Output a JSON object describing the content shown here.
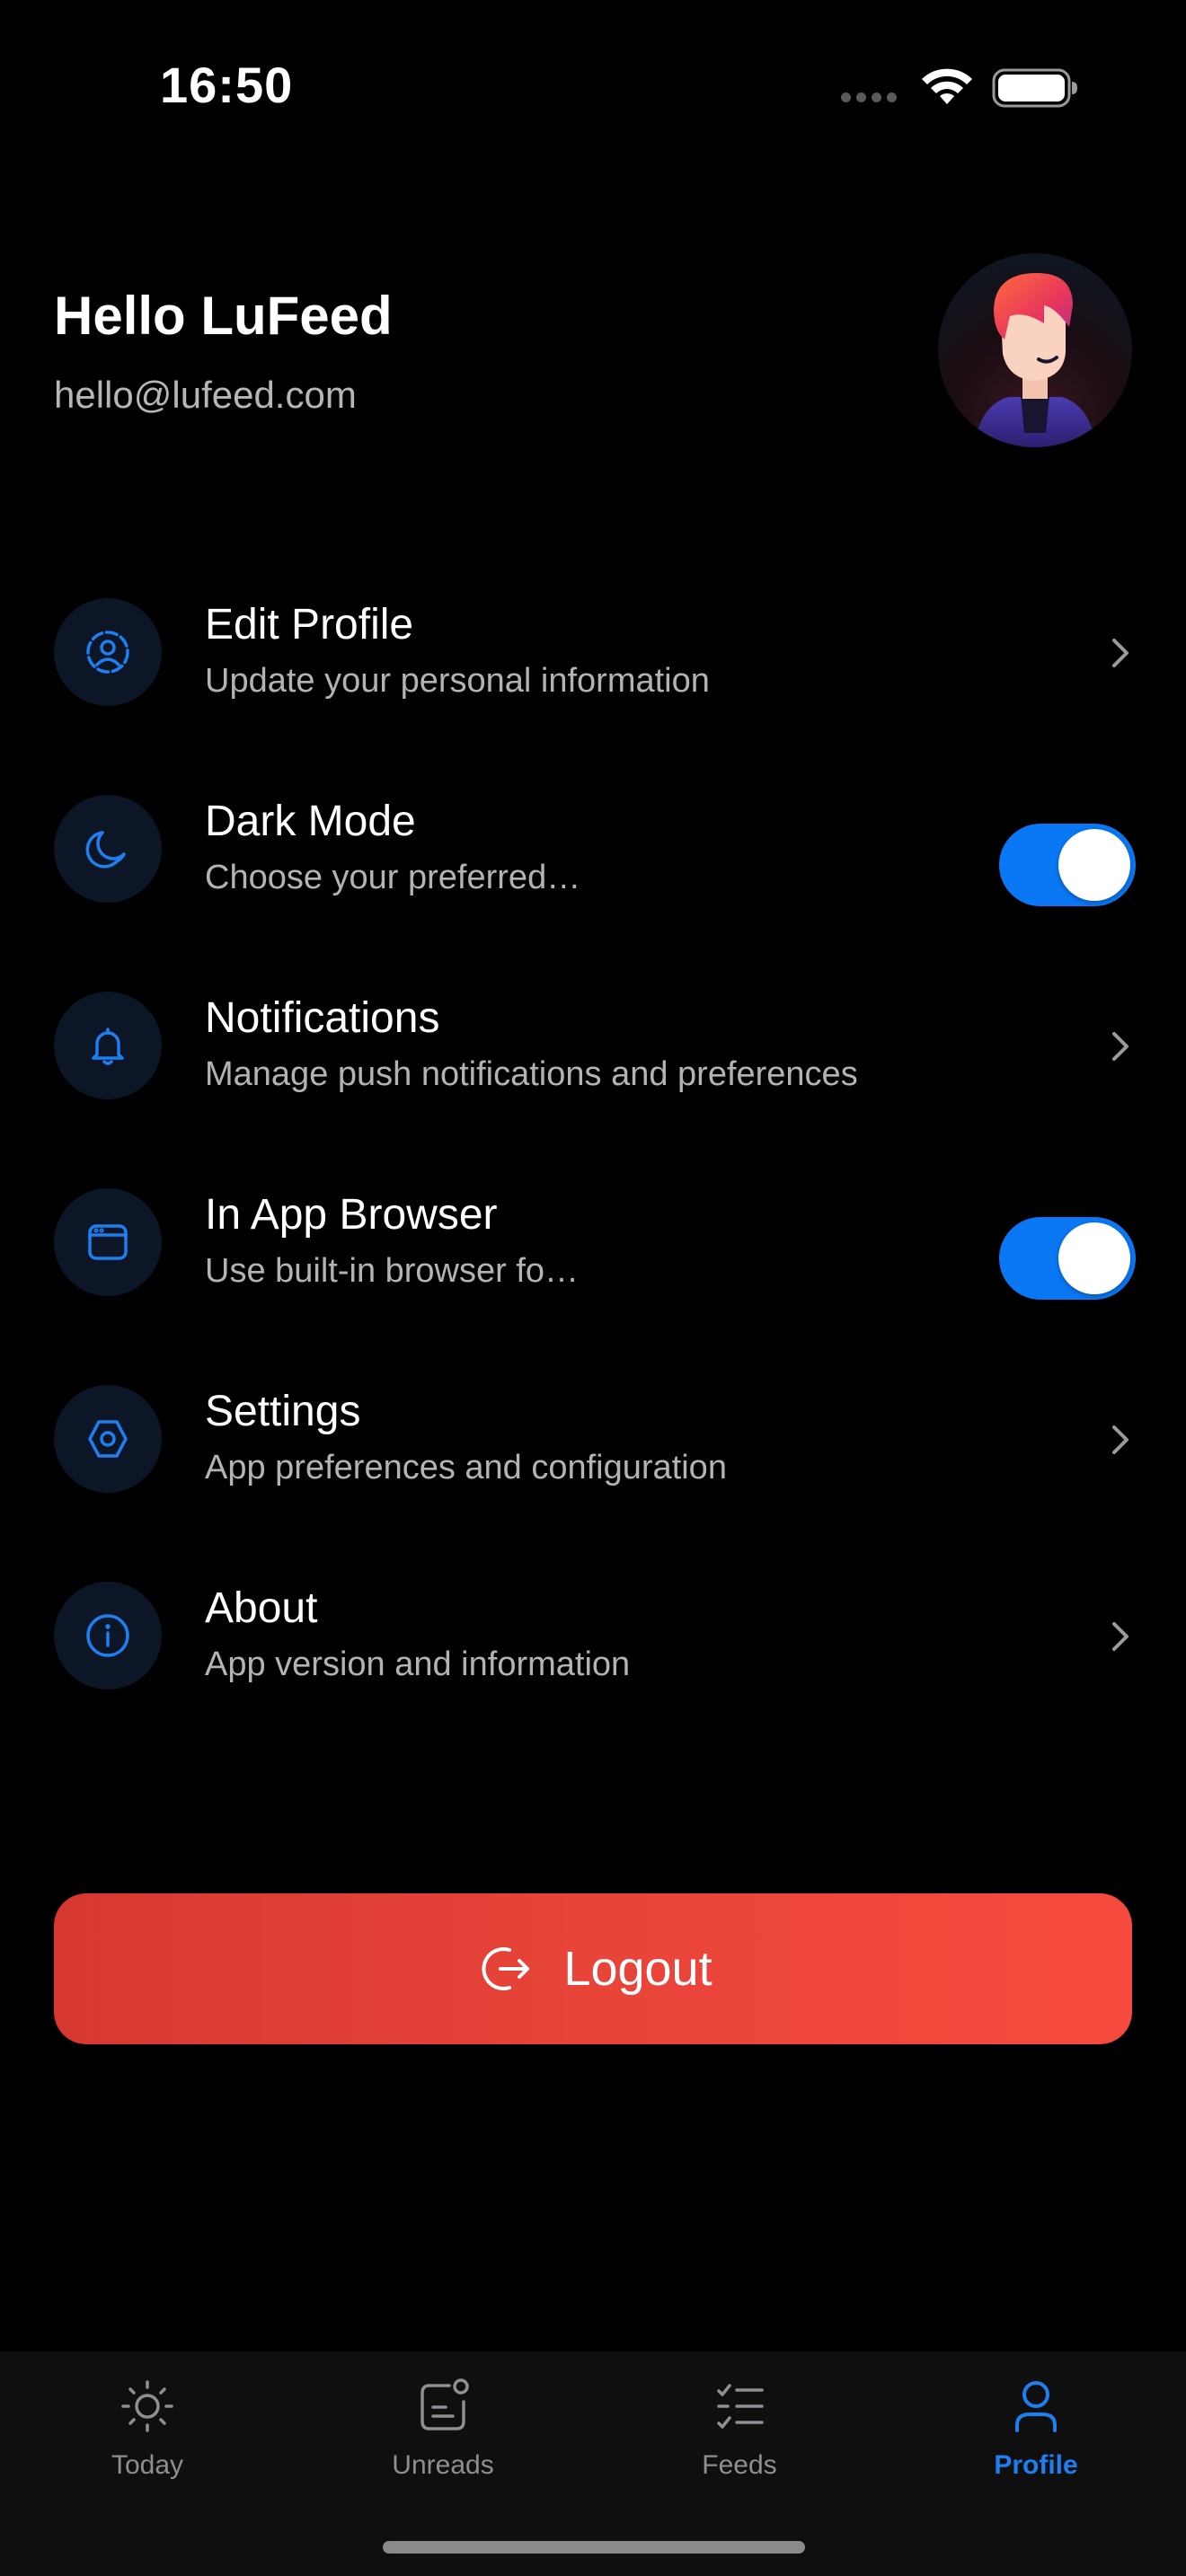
{
  "status_bar": {
    "time": "16:50"
  },
  "header": {
    "greeting": "Hello LuFeed",
    "email": "hello@lufeed.com"
  },
  "menu": {
    "items": [
      {
        "title": "Edit Profile",
        "subtitle": "Update your personal information",
        "icon": "user-circle-icon",
        "control": "chevron"
      },
      {
        "title": "Dark Mode",
        "subtitle": "Choose your preferred…",
        "icon": "moon-icon",
        "control": "toggle",
        "on": true
      },
      {
        "title": "Notifications",
        "subtitle": "Manage push notifications and preferences",
        "icon": "bell-icon",
        "control": "chevron"
      },
      {
        "title": "In App Browser",
        "subtitle": "Use built-in browser fo…",
        "icon": "browser-window-icon",
        "control": "toggle",
        "on": true
      },
      {
        "title": "Settings",
        "subtitle": "App preferences and configuration",
        "icon": "hexagon-settings-icon",
        "control": "chevron"
      },
      {
        "title": "About",
        "subtitle": "App version and information",
        "icon": "info-icon",
        "control": "chevron"
      }
    ]
  },
  "logout": {
    "label": "Logout"
  },
  "tabs": [
    {
      "label": "Today",
      "icon": "sun-icon",
      "active": false
    },
    {
      "label": "Unreads",
      "icon": "unread-badge-icon",
      "active": false
    },
    {
      "label": "Feeds",
      "icon": "checklist-icon",
      "active": false
    },
    {
      "label": "Profile",
      "icon": "person-icon",
      "active": true
    }
  ],
  "colors": {
    "background": "#000000",
    "accent": "#0a78f5",
    "icon_blue": "#1e7ff0",
    "icon_circle_bg": "#0c1626",
    "logout_start": "#d6382f",
    "logout_end": "#f74a3e",
    "tab_inactive": "#8e8e93"
  }
}
